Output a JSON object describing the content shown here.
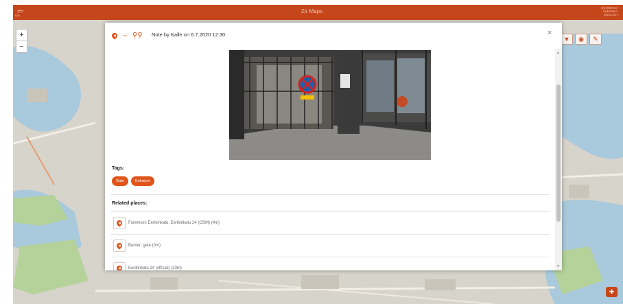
{
  "appbar": {
    "title": "Zir Maps",
    "exit_label": "Exit",
    "lang_lines": [
      "SUOMEKSI",
      "SVENSKA",
      "ENGLISH"
    ]
  },
  "map": {
    "zoom_in": "+",
    "zoom_out": "−"
  },
  "note": {
    "title": "Note by Kalle on 6.7.2020 12:30",
    "tags_label": "Tags:",
    "tags": [
      "Gate",
      "Entrance"
    ],
    "related_label": "Related places:",
    "related_places": [
      "Foremost: Eerikinkatu, Eerikinkatu 24 (OSM) (4m)",
      "Barrier: gate (0m)",
      "Eerikinkatu 24 (official) (23m)"
    ]
  },
  "colors": {
    "accent": "#e2551a",
    "appbar": "#c6461b"
  }
}
